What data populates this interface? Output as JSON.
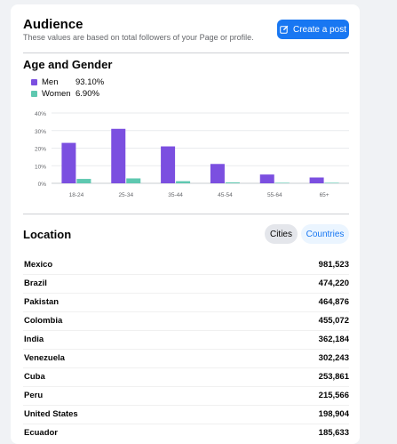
{
  "audience": {
    "title": "Audience",
    "subtitle": "These values are based on total followers of your Page or profile.",
    "create_post_label": "Create a post"
  },
  "age_gender": {
    "title": "Age and Gender",
    "legend": [
      {
        "name": "Men",
        "value": "93.10%",
        "color": "#7b4fe0"
      },
      {
        "name": "Women",
        "value": "6.90%",
        "color": "#5ec8b0"
      }
    ]
  },
  "chart_data": {
    "type": "bar",
    "categories": [
      "18-24",
      "25-34",
      "35-44",
      "45-54",
      "55-64",
      "65+"
    ],
    "series": [
      {
        "name": "Men",
        "values": [
          23,
          31,
          21,
          11,
          5,
          3.3
        ],
        "color": "#7b4fe0"
      },
      {
        "name": "Women",
        "values": [
          2.5,
          2.8,
          1.2,
          0.5,
          0.3,
          0.3
        ],
        "color": "#5ec8b0"
      }
    ],
    "yticks": [
      "0%",
      "10%",
      "20%",
      "30%",
      "40%"
    ],
    "ylim": [
      0,
      40
    ],
    "grid": true
  },
  "location": {
    "title": "Location",
    "tabs": [
      {
        "label": "Cities",
        "active": true
      },
      {
        "label": "Countries",
        "active": false
      }
    ],
    "rows": [
      {
        "name": "Mexico",
        "value": "981,523"
      },
      {
        "name": "Brazil",
        "value": "474,220"
      },
      {
        "name": "Pakistan",
        "value": "464,876"
      },
      {
        "name": "Colombia",
        "value": "455,072"
      },
      {
        "name": "India",
        "value": "362,184"
      },
      {
        "name": "Venezuela",
        "value": "302,243"
      },
      {
        "name": "Cuba",
        "value": "253,861"
      },
      {
        "name": "Peru",
        "value": "215,566"
      },
      {
        "name": "United States",
        "value": "198,904"
      },
      {
        "name": "Ecuador",
        "value": "185,633"
      }
    ]
  }
}
